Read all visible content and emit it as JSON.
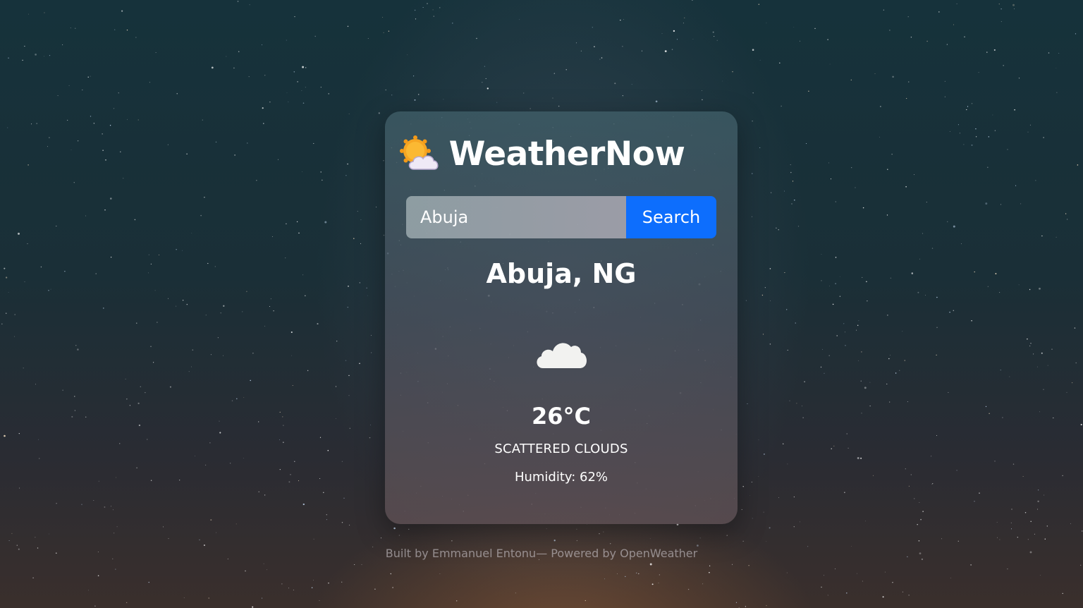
{
  "app": {
    "title": "WeatherNow",
    "logo_icon": "sun-behind-cloud-icon"
  },
  "search": {
    "value": "Abuja",
    "button_label": "Search"
  },
  "weather": {
    "location": "Abuja, NG",
    "icon": "cloud-icon",
    "temperature": "26°C",
    "description": "SCATTERED CLOUDS",
    "humidity": "Humidity: 62%"
  },
  "footer": {
    "text": "Built by Emmanuel Entonu— Powered by OpenWeather"
  },
  "colors": {
    "accent": "#0d6efd",
    "text": "#ffffff"
  }
}
